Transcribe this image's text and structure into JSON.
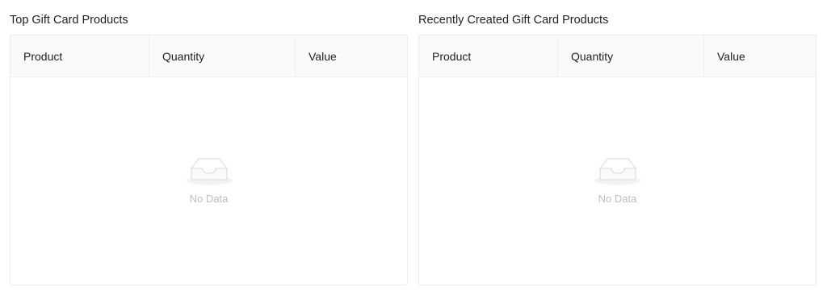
{
  "panels": [
    {
      "title": "Top Gift Card Products",
      "columns": [
        "Product",
        "Quantity",
        "Value"
      ],
      "empty_text": "No Data"
    },
    {
      "title": "Recently Created Gift Card Products",
      "columns": [
        "Product",
        "Quantity",
        "Value"
      ],
      "empty_text": "No Data"
    }
  ],
  "icons": {
    "empty_state": "empty-inbox-icon"
  },
  "colors": {
    "header_bg": "#fafafa",
    "border": "#ededed",
    "empty_text": "#bfbfbf"
  }
}
